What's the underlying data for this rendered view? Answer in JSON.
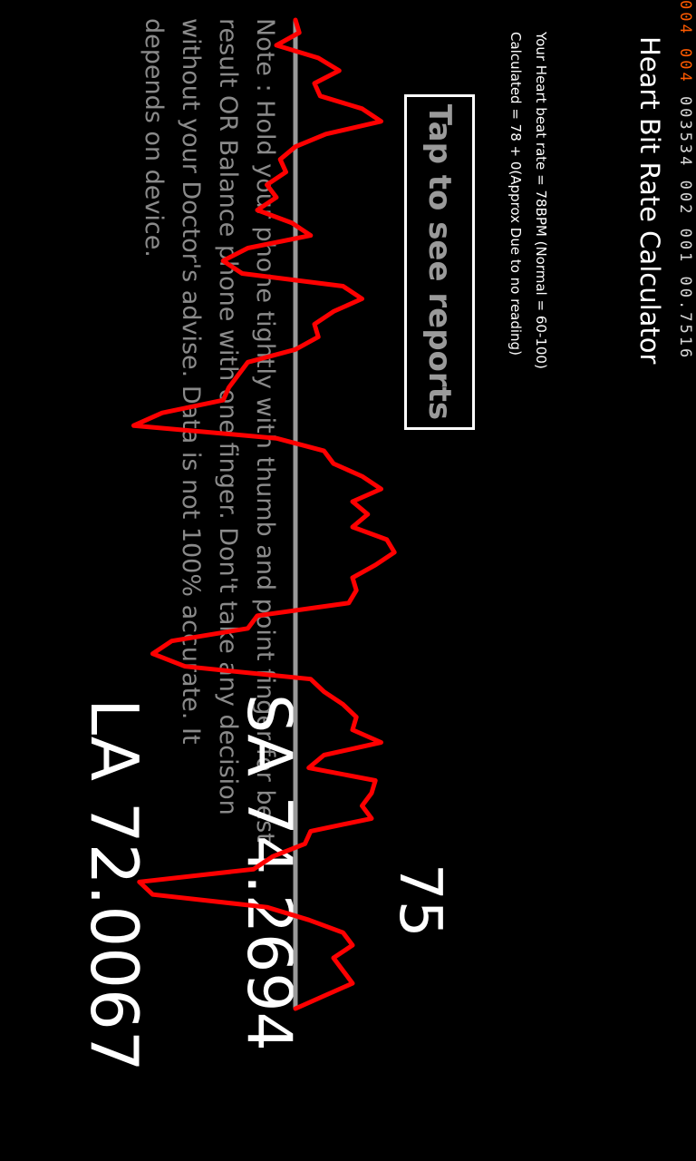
{
  "debug": {
    "value_1": "004",
    "value_2": "004",
    "value_3": "003534",
    "value_4": "002",
    "value_5": "001",
    "value_6": "00.7516"
  },
  "app": {
    "title": "Heart Bit Rate Calculator"
  },
  "result": {
    "rate_line": "Your Heart beat rate = 78BPM (Normal = 60-100)",
    "calc_line": "Calculated = 78  +  0(Approx Due to no reading)"
  },
  "reports_button": {
    "label": "Tap to see reports"
  },
  "note": {
    "text": "Note : Hold your phone tightly with thumb and point finger for best result OR Balance phone with one finger. Don't take any decision without your Doctor's advise. Data is not 100% accurate. It depends on device."
  },
  "readings": {
    "bpm": "75",
    "sa": "SA 74.2694",
    "la": "LA 72.0067"
  },
  "colors": {
    "background": "#000000",
    "trace": "#ff0000",
    "highlight": "#ff5a00",
    "baseline": "#9a9a9a"
  },
  "chart_data": {
    "type": "line",
    "series": [
      {
        "values": [
          0,
          0.02,
          -0.1,
          0.12,
          0.23,
          0.1,
          0.13,
          0.35,
          0.45,
          0.16,
          0,
          -0.08,
          -0.05,
          -0.15,
          -0.1,
          -0.2,
          -0.02,
          0.08,
          -0.25,
          -0.38,
          -0.28,
          0.25,
          0.35,
          0.2,
          0.1,
          0.12,
          0,
          -0.25,
          -0.3,
          -0.35,
          -0.38,
          -0.7,
          -0.85,
          -0.1,
          0.15,
          0.2,
          0.35,
          0.45,
          0.3,
          0.38,
          0.3,
          0.48,
          0.52,
          0.42,
          0.3,
          0.32,
          0.28,
          -0.2,
          -0.25,
          -0.65,
          -0.75,
          -0.58,
          0.08,
          0.15,
          0.25,
          0.32,
          0.3,
          0.45,
          0.15,
          0.07,
          0.42,
          0.4,
          0.35,
          0.4,
          0.08,
          0.05,
          -0.12,
          -0.22,
          -0.82,
          -0.75,
          -0.15,
          0.07,
          0.25,
          0.3,
          0.2,
          0.25,
          0.3,
          0.15,
          0
        ]
      }
    ]
  }
}
